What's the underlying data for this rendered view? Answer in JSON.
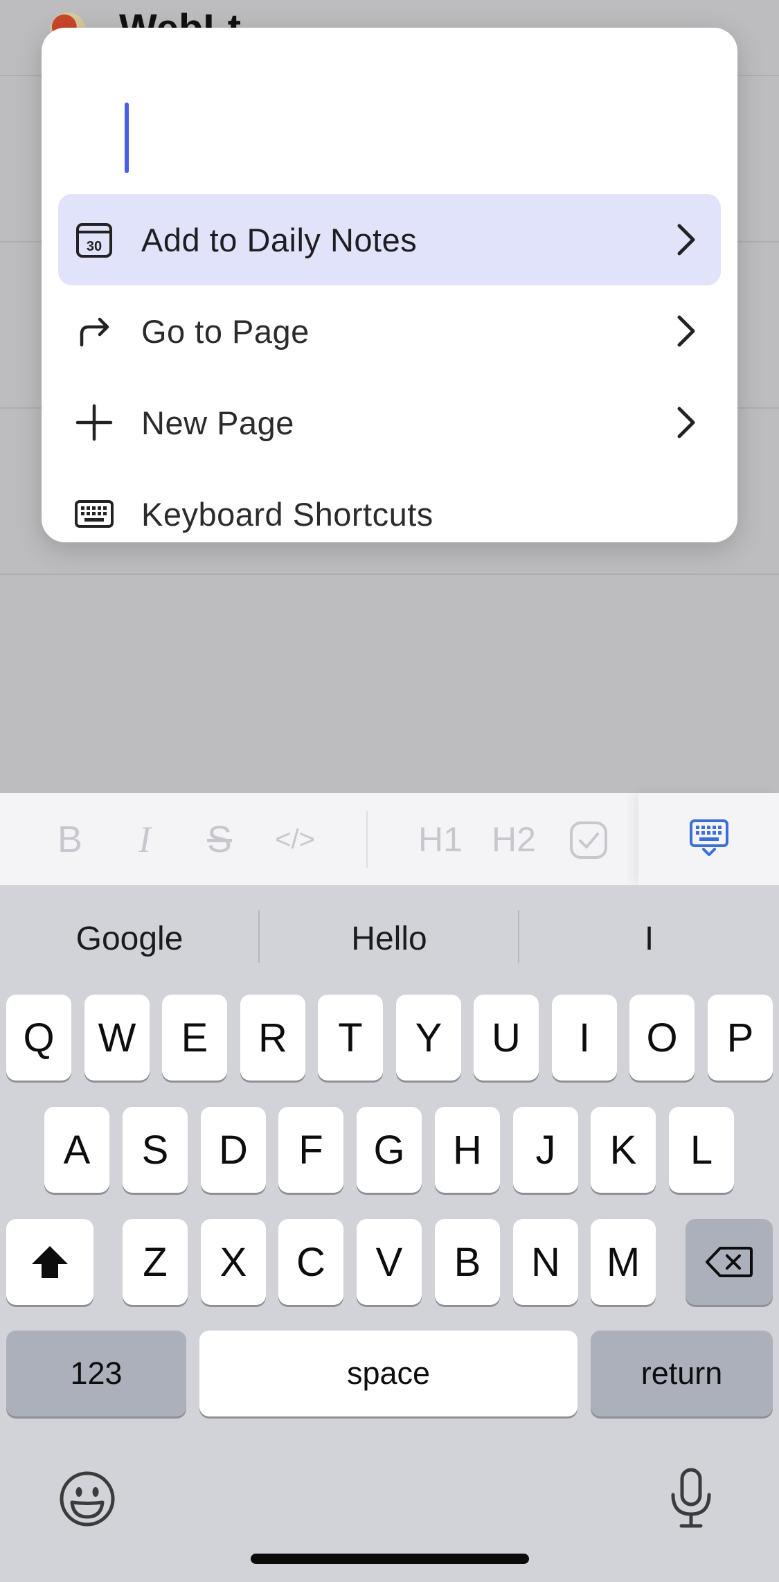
{
  "background": {
    "title": "WebLt"
  },
  "palette": {
    "input_value": "",
    "items": [
      {
        "label": "Add to Daily Notes",
        "icon": "calendar-30-icon",
        "has_chevron": true,
        "selected": true
      },
      {
        "label": "Go to Page",
        "icon": "arrow-turn-right-icon",
        "has_chevron": true,
        "selected": false
      },
      {
        "label": "New Page",
        "icon": "plus-icon",
        "has_chevron": true,
        "selected": false
      },
      {
        "label": "Keyboard Shortcuts",
        "icon": "keyboard-icon",
        "has_chevron": false,
        "selected": false
      }
    ],
    "calendar_icon_text": "30"
  },
  "toolbar": {
    "buttons": [
      {
        "label": "B",
        "name": "bold"
      },
      {
        "label": "I",
        "name": "italic"
      },
      {
        "label": "S",
        "name": "strikethrough"
      },
      {
        "label": "</>",
        "name": "code"
      },
      {
        "label": "H1",
        "name": "heading-1"
      },
      {
        "label": "H2",
        "name": "heading-2"
      },
      {
        "label": "",
        "name": "todo"
      }
    ],
    "accent_color": "#3a6fd8"
  },
  "keyboard": {
    "suggestions": [
      "Google",
      "Hello",
      "I"
    ],
    "row1": [
      "Q",
      "W",
      "E",
      "R",
      "T",
      "Y",
      "U",
      "I",
      "O",
      "P"
    ],
    "row2": [
      "A",
      "S",
      "D",
      "F",
      "G",
      "H",
      "J",
      "K",
      "L"
    ],
    "row3": [
      "Z",
      "X",
      "C",
      "V",
      "B",
      "N",
      "M"
    ],
    "numbers_label": "123",
    "space_label": "space",
    "return_label": "return"
  }
}
